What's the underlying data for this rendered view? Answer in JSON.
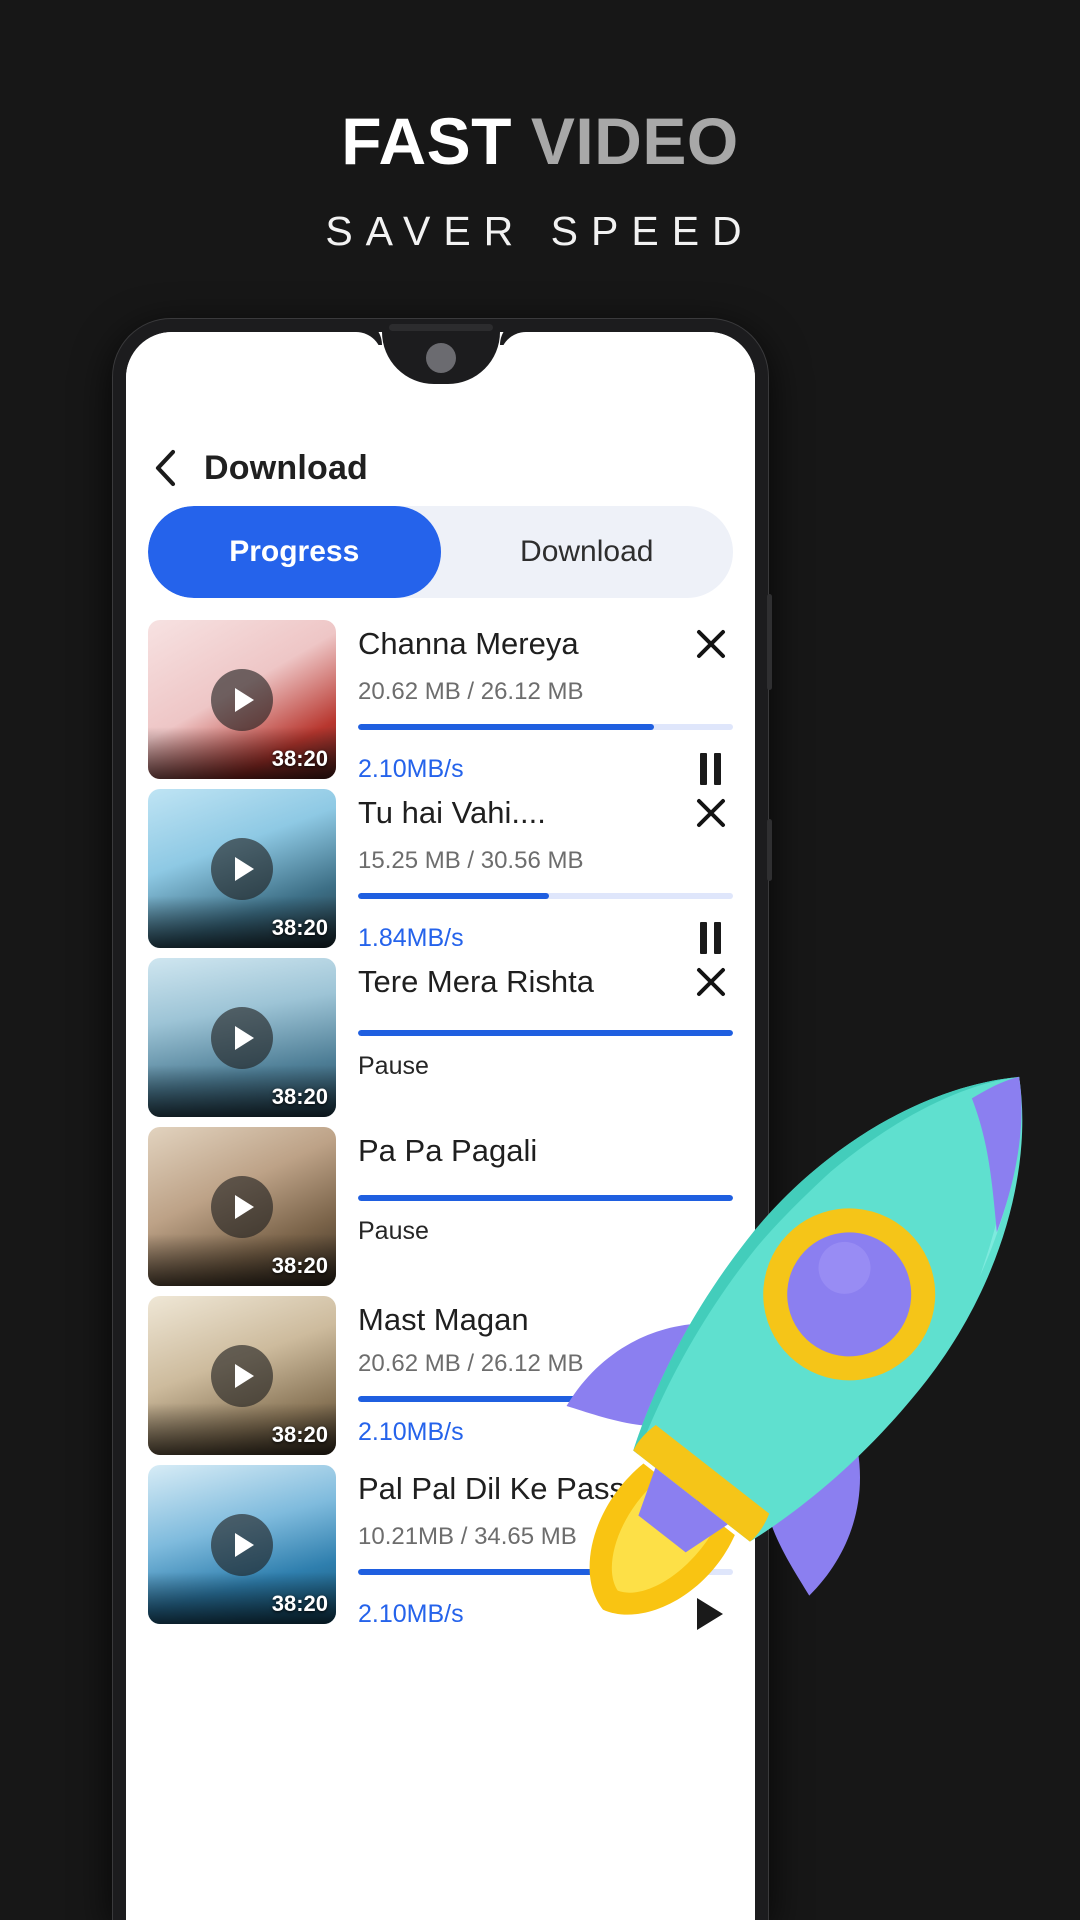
{
  "promo": {
    "headline_strong": "FAST",
    "headline_light": "VIDEO",
    "subheadline": "SAVER SPEED",
    "colors": {
      "background": "#171717",
      "headline_strong": "#ffffff",
      "headline_light": "#a8a8a8"
    }
  },
  "app": {
    "appbar": {
      "back_icon": "chevron-left-icon",
      "title": "Download"
    },
    "tabs": [
      {
        "label": "Progress",
        "active": true
      },
      {
        "label": "Download",
        "active": false
      }
    ],
    "colors": {
      "accent": "#2563eb",
      "progress_fill": "#1f5fe0",
      "progress_track": "#dfe6fb",
      "tabbar_bg": "#eef1f8"
    },
    "downloads": [
      {
        "title": "Channa Mereya",
        "duration": "38:20",
        "sizes": "20.62 MB / 26.12 MB",
        "speed": "2.10MB/s",
        "status": "",
        "progress_percent": 79,
        "control_icon": "pause-icon",
        "has_close": true,
        "thumb_colors": [
          "#f3d9d9",
          "#e8bcbc",
          "#c7342d"
        ]
      },
      {
        "title": "Tu hai Vahi....",
        "duration": "38:20",
        "sizes": "15.25 MB / 30.56 MB",
        "speed": "1.84MB/s",
        "status": "",
        "progress_percent": 51,
        "control_icon": "pause-icon",
        "has_close": true,
        "thumb_colors": [
          "#9fd8ef",
          "#5fb7dd",
          "#2b5f77"
        ]
      },
      {
        "title": "Tere Mera Rishta",
        "duration": "38:20",
        "sizes": "",
        "speed": "",
        "status": "Pause",
        "progress_percent": 100,
        "control_icon": "",
        "has_close": true,
        "thumb_colors": [
          "#a9cfe0",
          "#6f9fb8",
          "#2e5b70"
        ]
      },
      {
        "title": "Pa Pa Pagali",
        "duration": "38:20",
        "sizes": "",
        "speed": "",
        "status": "Pause",
        "progress_percent": 100,
        "control_icon": "",
        "has_close": false,
        "thumb_colors": [
          "#d8c6b2",
          "#a98f73",
          "#4a3b2c"
        ]
      },
      {
        "title": "Mast Magan",
        "duration": "38:20",
        "sizes": "20.62 MB / 26.12 MB",
        "speed": "2.10MB/s",
        "status": "",
        "progress_percent": 79,
        "control_icon": "",
        "has_close": false,
        "thumb_colors": [
          "#e5dcc9",
          "#c3b195",
          "#6a5a44"
        ]
      },
      {
        "title": "Pal Pal Dil Ke Pass",
        "duration": "38:20",
        "sizes": "10.21MB / 34.65 MB",
        "speed": "2.10MB/s",
        "status": "",
        "progress_percent": 86,
        "control_icon": "play-icon",
        "has_close": true,
        "thumb_colors": [
          "#bfe0ef",
          "#5aa9d6",
          "#17516f"
        ]
      }
    ]
  },
  "decor": {
    "rocket_icon": "rocket-icon"
  }
}
